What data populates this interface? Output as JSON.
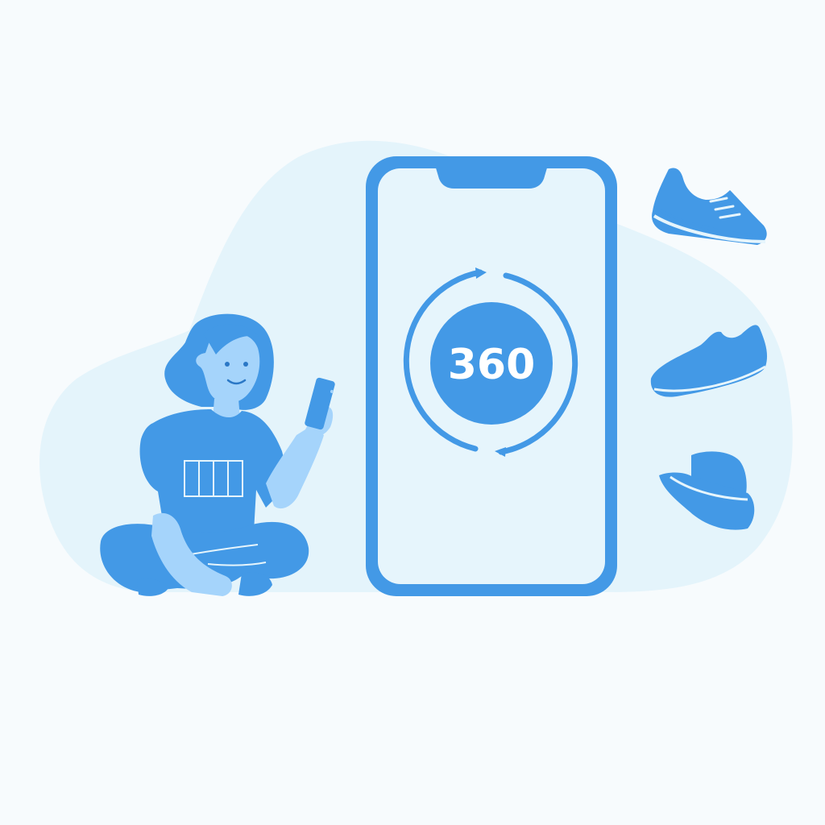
{
  "phone_screen": {
    "badge_text": "360"
  },
  "colors": {
    "background": "#f7fbfd",
    "blob": "#e4f4fb",
    "primary_blue": "#4399e6",
    "light_blue": "#a5d4fb",
    "screen_fill": "#e6f5fc",
    "dark_outline": "#2b78c6"
  },
  "icons": [
    "person-holding-phone",
    "sneaker-icon",
    "sneaker-icon",
    "bucket-hat-icon",
    "rotate-360-icon"
  ]
}
